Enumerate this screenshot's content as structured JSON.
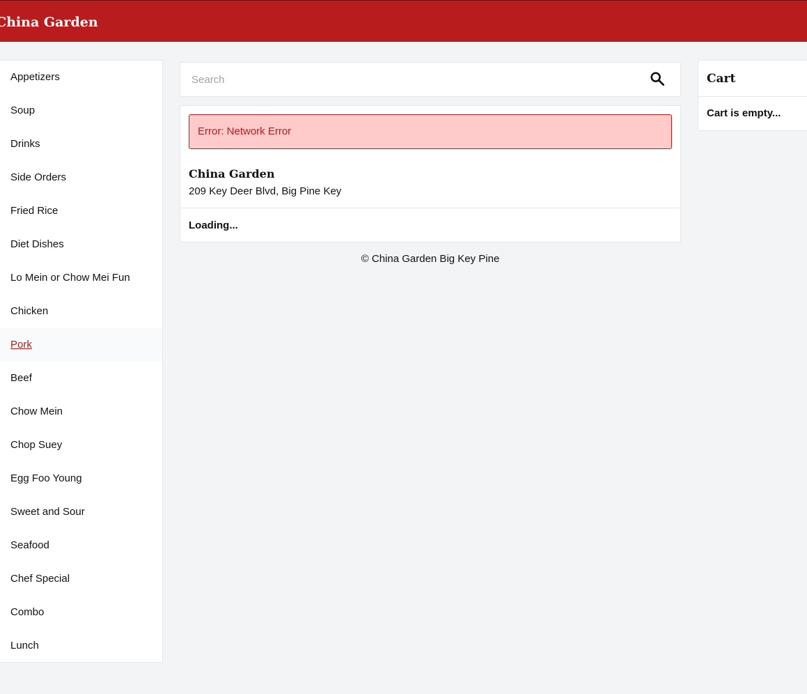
{
  "header": {
    "brand": "China Garden"
  },
  "sidebar": {
    "items": [
      {
        "label": "Appetizers"
      },
      {
        "label": "Soup"
      },
      {
        "label": "Drinks"
      },
      {
        "label": "Side Orders"
      },
      {
        "label": "Fried Rice"
      },
      {
        "label": "Diet Dishes"
      },
      {
        "label": "Lo Mein or Chow Mei Fun"
      },
      {
        "label": "Chicken"
      },
      {
        "label": "Pork"
      },
      {
        "label": "Beef"
      },
      {
        "label": "Chow Mein"
      },
      {
        "label": "Chop Suey"
      },
      {
        "label": "Egg Foo Young"
      },
      {
        "label": "Sweet and Sour"
      },
      {
        "label": "Seafood"
      },
      {
        "label": "Chef Special"
      },
      {
        "label": "Combo"
      },
      {
        "label": "Lunch"
      }
    ],
    "active_item": "Pork"
  },
  "search": {
    "placeholder": "Search",
    "value": "",
    "icon": "search-icon"
  },
  "main": {
    "error_message": "Error: Network Error",
    "restaurant_name": "China Garden",
    "restaurant_address": "209 Key Deer Blvd, Big Pine Key",
    "loading_text": "Loading..."
  },
  "footer": {
    "text": "© China Garden Big Key Pine"
  },
  "cart": {
    "title": "Cart",
    "empty_text": "Cart is empty..."
  },
  "colors": {
    "brand_red": "#b91c1c",
    "error_bg": "#fecaca",
    "page_bg": "#f3f4f6"
  }
}
